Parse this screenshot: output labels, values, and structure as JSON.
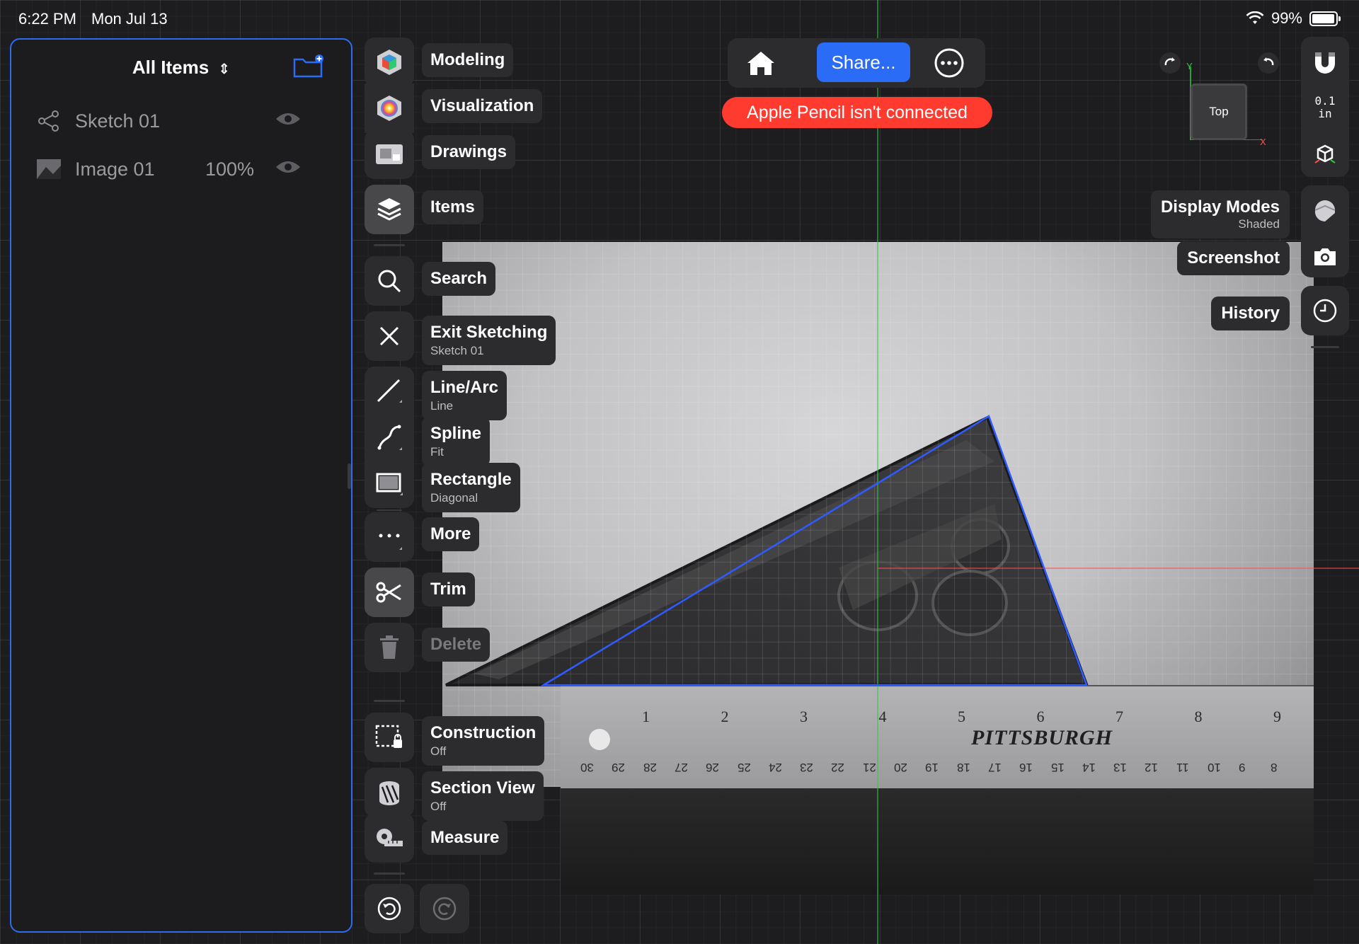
{
  "status": {
    "time": "6:22 PM",
    "date": "Mon Jul 13",
    "battery": "99%"
  },
  "sidebar": {
    "title": "All Items",
    "items": [
      {
        "label": "Sketch 01",
        "percent": "",
        "icon": "sketch-icon"
      },
      {
        "label": "Image 01",
        "percent": "100%",
        "icon": "image-icon"
      }
    ]
  },
  "toolbar": {
    "workspaces": [
      {
        "label": "Modeling",
        "icon": "modeling-icon"
      },
      {
        "label": "Visualization",
        "icon": "visualization-icon"
      },
      {
        "label": "Drawings",
        "icon": "drawings-icon"
      }
    ],
    "items": {
      "label": "Items"
    },
    "search": {
      "label": "Search"
    },
    "exit": {
      "label": "Exit Sketching",
      "sub": "Sketch 01"
    },
    "line": {
      "label": "Line/Arc",
      "sub": "Line"
    },
    "spline": {
      "label": "Spline",
      "sub": "Fit"
    },
    "rectangle": {
      "label": "Rectangle",
      "sub": "Diagonal"
    },
    "more": {
      "label": "More"
    },
    "trim": {
      "label": "Trim"
    },
    "delete": {
      "label": "Delete"
    },
    "construction": {
      "label": "Construction",
      "sub": "Off"
    },
    "section": {
      "label": "Section View",
      "sub": "Off"
    },
    "measure": {
      "label": "Measure"
    }
  },
  "topbar": {
    "share": "Share...",
    "alert": "Apple Pencil isn't connected"
  },
  "right": {
    "view": "Top",
    "axis_y": "Y",
    "axis_x": "X",
    "snap_value": "0.1",
    "snap_unit": "in",
    "display_modes": {
      "label": "Display Modes",
      "sub": "Shaded"
    },
    "screenshot": {
      "label": "Screenshot"
    },
    "history": {
      "label": "History"
    }
  },
  "ruler": {
    "brand": "PITTSBURGH",
    "inch_ticks": [
      "1",
      "2",
      "3",
      "4",
      "5",
      "6",
      "7",
      "8",
      "9"
    ],
    "cm_ticks": [
      "30",
      "29",
      "28",
      "27",
      "26",
      "25",
      "24",
      "23",
      "22",
      "21",
      "20",
      "19",
      "18",
      "17",
      "16",
      "15",
      "14",
      "13",
      "12",
      "11",
      "10",
      "9",
      "8"
    ]
  },
  "colors": {
    "accent": "#2a6cf5",
    "alert": "#ff3b30",
    "sketch_line": "#2f5bff"
  }
}
